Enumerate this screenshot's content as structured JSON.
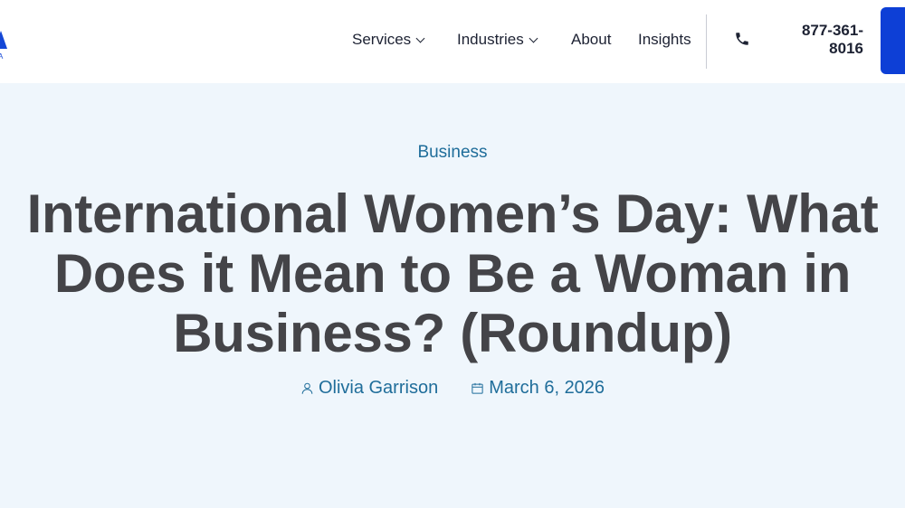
{
  "header": {
    "logo_sub": "A",
    "nav": [
      {
        "label": "Services",
        "has_dropdown": true
      },
      {
        "label": "Industries",
        "has_dropdown": true
      },
      {
        "label": "About",
        "has_dropdown": false
      },
      {
        "label": "Insights",
        "has_dropdown": false
      }
    ],
    "phone_line1": "877-361-",
    "phone_line2": "8016"
  },
  "article": {
    "category": "Business",
    "title": "International Women’s Day: What Does it Mean to Be a Woman in Business? (Roundup)",
    "author": "Olivia Garrison",
    "date": "March 6, 2026"
  },
  "colors": {
    "brand_blue": "#0d3fd6",
    "link_teal": "#1f6d9a",
    "hero_bg": "#eff6fc",
    "title_gray": "#444448"
  },
  "icons": {
    "phone": "phone-icon",
    "author": "user-icon",
    "date": "calendar-icon",
    "dropdown": "chevron-down-icon"
  }
}
